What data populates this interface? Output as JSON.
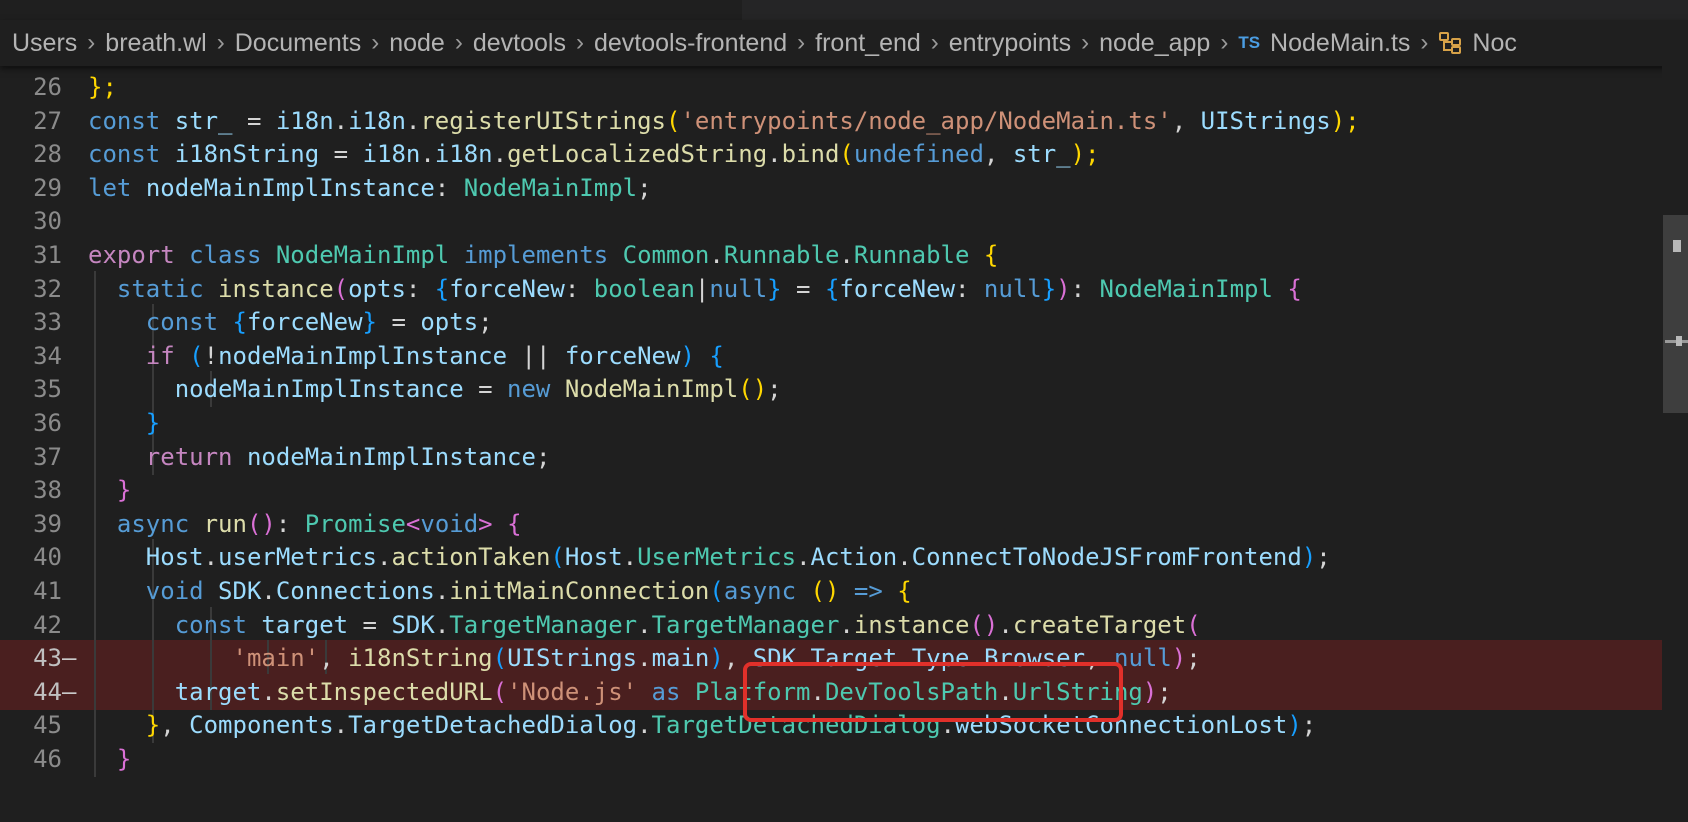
{
  "breadcrumb": {
    "segments": [
      "Users",
      "breath.wl",
      "Documents",
      "node",
      "devtools",
      "devtools-frontend",
      "front_end",
      "entrypoints",
      "node_app"
    ],
    "file_badge": "TS",
    "file_name": "NodeMain.ts",
    "symbol_truncated": "Noc"
  },
  "line_numbers": [
    "26",
    "27",
    "28",
    "29",
    "30",
    "31",
    "32",
    "33",
    "34",
    "35",
    "36",
    "37",
    "38",
    "39",
    "40",
    "41",
    "42",
    "43",
    "44",
    "45",
    "46"
  ],
  "deleted_marker": "—",
  "code": {
    "l26": [
      "};"
    ],
    "l27": [
      "const",
      " ",
      "str_",
      " = ",
      "i18n",
      ".",
      "i18n",
      ".",
      "registerUIStrings",
      "(",
      "'entrypoints/node_app/NodeMain.ts'",
      ", ",
      "UIStrings",
      ");"
    ],
    "l28": [
      "const",
      " ",
      "i18nString",
      " = ",
      "i18n",
      ".",
      "i18n",
      ".",
      "getLocalizedString",
      ".",
      "bind",
      "(",
      "undefined",
      ", ",
      "str_",
      ");"
    ],
    "l29": [
      "let",
      " ",
      "nodeMainImplInstance",
      ": ",
      "NodeMainImpl",
      ";"
    ],
    "l31": [
      "export",
      " ",
      "class",
      " ",
      "NodeMainImpl",
      " ",
      "implements",
      " ",
      "Common",
      ".",
      "Runnable",
      ".",
      "Runnable",
      " ",
      "{"
    ],
    "l32": [
      "static",
      " ",
      "instance",
      "(",
      "opts",
      ": ",
      "{",
      "forceNew",
      ": ",
      "boolean",
      "|",
      "null",
      "}",
      " = ",
      "{",
      "forceNew",
      ": ",
      "null",
      "}",
      ")",
      ": ",
      "NodeMainImpl",
      " ",
      "{"
    ],
    "l33": [
      "const",
      " ",
      "{",
      "forceNew",
      "}",
      " = ",
      "opts",
      ";"
    ],
    "l34": [
      "if",
      " ",
      "(",
      "!",
      "nodeMainImplInstance",
      " || ",
      "forceNew",
      ")",
      " ",
      "{"
    ],
    "l35": [
      "nodeMainImplInstance",
      " = ",
      "new",
      " ",
      "NodeMainImpl",
      "(",
      ")",
      ";"
    ],
    "l36": [
      "}"
    ],
    "l37": [
      "return",
      " ",
      "nodeMainImplInstance",
      ";"
    ],
    "l38": [
      "}"
    ],
    "l39": [
      "async",
      " ",
      "run",
      "(",
      ")",
      ": ",
      "Promise",
      "<",
      "void",
      ">",
      " ",
      "{"
    ],
    "l40": [
      "Host",
      ".",
      "userMetrics",
      ".",
      "actionTaken",
      "(",
      "Host",
      ".",
      "UserMetrics",
      ".",
      "Action",
      ".",
      "ConnectToNodeJSFromFrontend",
      ")",
      ";"
    ],
    "l41": [
      "void",
      " ",
      "SDK",
      ".",
      "Connections",
      ".",
      "initMainConnection",
      "(",
      "async",
      " ",
      "(",
      ")",
      " ",
      "=>",
      " ",
      "{"
    ],
    "l42": [
      "const",
      " ",
      "target",
      " = ",
      "SDK",
      ".",
      "TargetManager",
      ".",
      "TargetManager",
      ".",
      "instance",
      "(",
      ")",
      ".",
      "createTarget",
      "("
    ],
    "l43": [
      "'main'",
      ", ",
      "i18nString",
      "(",
      "UIStrings",
      ".",
      "main",
      ")",
      ", ",
      "SDK",
      ".",
      "Target",
      ".",
      "Type",
      ".",
      "Browser",
      ", ",
      "null",
      ")",
      ";"
    ],
    "l44": [
      "target",
      ".",
      "setInspectedURL",
      "(",
      "'Node.js'",
      " ",
      "as",
      " ",
      "Platform",
      ".",
      "DevToolsPath",
      ".",
      "UrlString",
      ")",
      ";"
    ],
    "l45": [
      "}",
      ", ",
      "Components",
      ".",
      "TargetDetachedDialog",
      ".",
      "TargetDetachedDialog",
      ".",
      "webSocketConnectionLost",
      ")",
      ";"
    ],
    "l46": [
      "}"
    ]
  },
  "annotation": {
    "highlighted_text": "SDK.Target.Type.Browser,",
    "box_color": "#e0302a"
  },
  "colors": {
    "background": "#1f1f1f",
    "deleted_line": "#4a1f1f",
    "keyword": "#569cd6",
    "control": "#c586c0",
    "function": "#dcdcaa",
    "type": "#4ec9b0",
    "string": "#ce9178",
    "variable": "#9cdcfe"
  }
}
